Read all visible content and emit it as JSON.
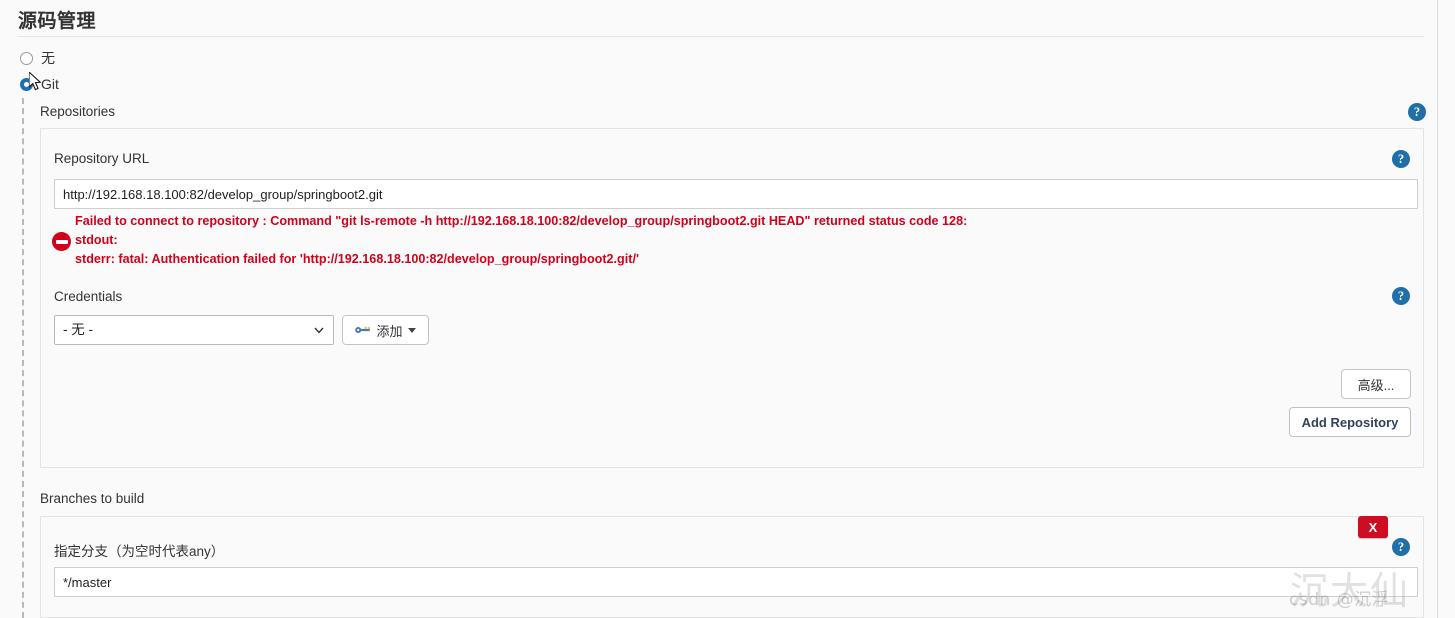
{
  "section": {
    "title": "源码管理"
  },
  "scm_options": [
    {
      "label": "无",
      "checked": false,
      "name": "scm-none"
    },
    {
      "label": "Git",
      "checked": true,
      "name": "scm-git"
    }
  ],
  "repositories": {
    "label": "Repositories",
    "help": "?",
    "repository_url": {
      "label": "Repository URL",
      "value": "http://192.168.18.100:82/develop_group/springboot2.git",
      "placeholder": "",
      "help": "?"
    },
    "error": {
      "icon": "error-circle-icon",
      "line1": "Failed to connect to repository : Command \"git ls-remote -h http://192.168.18.100:82/develop_group/springboot2.git HEAD\" returned status code 128:",
      "line2": "stdout:",
      "line3": "stderr: fatal: Authentication failed for 'http://192.168.18.100:82/develop_group/springboot2.git/'"
    },
    "credentials": {
      "label": "Credentials",
      "help": "?",
      "selected": "- 无 -",
      "options": [
        "- 无 -"
      ],
      "add_button": {
        "label": "添加",
        "icon": "key-icon",
        "caret": true
      }
    },
    "advanced_button": "高级...",
    "add_repository_button": "Add Repository"
  },
  "branches": {
    "label": "Branches to build",
    "delete_button": "X",
    "help": "?",
    "branch_spec": {
      "label": "指定分支（为空时代表any）",
      "value": "*/master",
      "placeholder": ""
    }
  },
  "watermark": {
    "big": "沉大仙",
    "small": "csdn @沉浮"
  },
  "colors": {
    "accent_blue": "#1f6fa8",
    "error_red": "#d0021b",
    "x_red": "#cc0d22",
    "panel_bg": "#fafafa",
    "panel_border": "#e3e3e3"
  }
}
